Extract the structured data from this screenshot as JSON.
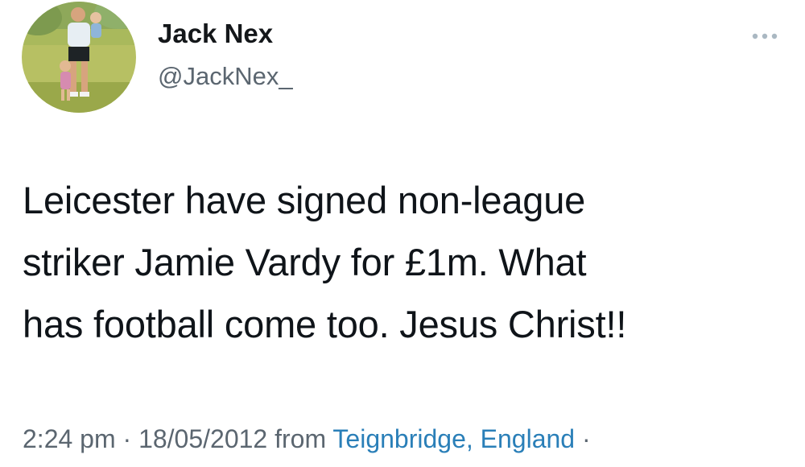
{
  "author": {
    "display_name": "Jack Nex",
    "handle": "@JackNex_"
  },
  "menu": {
    "more_icon": "more-horizontal-icon"
  },
  "tweet": {
    "lines": [
      "Leicester have signed non-league",
      "striker Jamie Vardy for £1m. What",
      "has football come too. Jesus Christ!!"
    ]
  },
  "meta": {
    "time": "2:24 pm",
    "separator": "·",
    "date": "18/05/2012",
    "from_label": "from",
    "location": "Teignbridge, England",
    "trailing_separator": "·"
  },
  "colors": {
    "text": "#0f1419",
    "muted": "#5b6670",
    "link": "#2a7fb8",
    "background": "#ffffff"
  }
}
